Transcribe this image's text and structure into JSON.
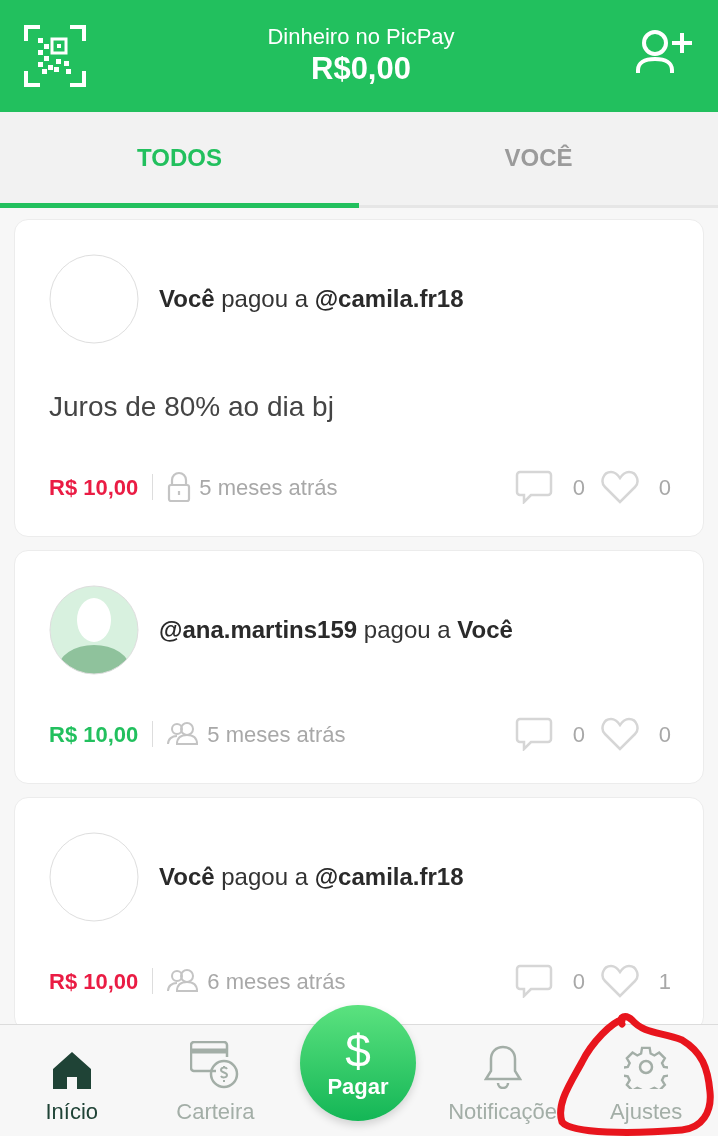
{
  "header": {
    "label": "Dinheiro no PicPay",
    "balance": "R$0,00"
  },
  "tabs": [
    {
      "label": "TODOS",
      "selected": true
    },
    {
      "label": "VOCÊ",
      "selected": false
    }
  ],
  "feed": [
    {
      "kind": "sent",
      "has_photo": false,
      "private": true,
      "text": "**Você** pagou a **@camila.fr18**",
      "message": "Juros de 80% ao dia bj",
      "amount": "R$ 10,00",
      "time": "5 meses atrás",
      "comments": "0",
      "likes": "0"
    },
    {
      "kind": "received",
      "has_photo": true,
      "private": false,
      "text": "**@ana.martins159** pagou a **Você**",
      "amount": "R$ 10,00",
      "time": "5 meses atrás",
      "comments": "0",
      "likes": "0"
    },
    {
      "kind": "sent",
      "has_photo": false,
      "private": false,
      "text": "**Você** pagou a **@camila.fr18**",
      "amount": "R$ 10,00",
      "time": "6 meses atrás",
      "comments": "0",
      "likes": "1"
    }
  ],
  "nav": [
    {
      "kind": "tab",
      "label": "Início",
      "selected": true
    },
    {
      "kind": "tab",
      "label": "Carteira",
      "selected": false
    },
    {
      "kind": "action",
      "symbol": "$",
      "label": "Pagar"
    },
    {
      "kind": "tab",
      "label": "Notificaçõe",
      "selected": false
    },
    {
      "kind": "tab",
      "label": "Ajustes",
      "selected": false
    }
  ]
}
